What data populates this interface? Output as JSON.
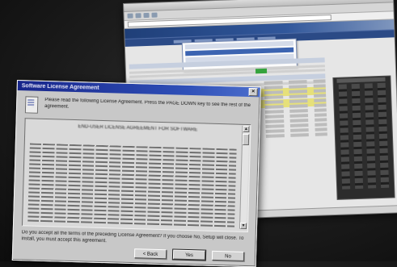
{
  "dialog": {
    "title": "Software License Agreement",
    "intro": "Please read the following License Agreement. Press the PAGE DOWN key to see the rest of the agreement.",
    "license_heading": "END-USER LICENSE AGREEMENT FOR SOFTWARE",
    "question": "Do you accept all the terms of the preceding License Agreement? If you choose No, Setup will close. To install, you must accept this agreement.",
    "buttons": {
      "back": "< Back",
      "yes": "Yes",
      "no": "No"
    },
    "close_glyph": "×",
    "scroll_up_glyph": "▲",
    "scroll_down_glyph": "▼"
  },
  "icons": [
    "document-icon",
    "close-icon"
  ],
  "colors": {
    "titlebar": "#17258a",
    "dialog_face": "#c8c8c8",
    "site_header": "#1f3f78",
    "highlight_row": "#e6e07a",
    "status_green": "#35a33d"
  }
}
